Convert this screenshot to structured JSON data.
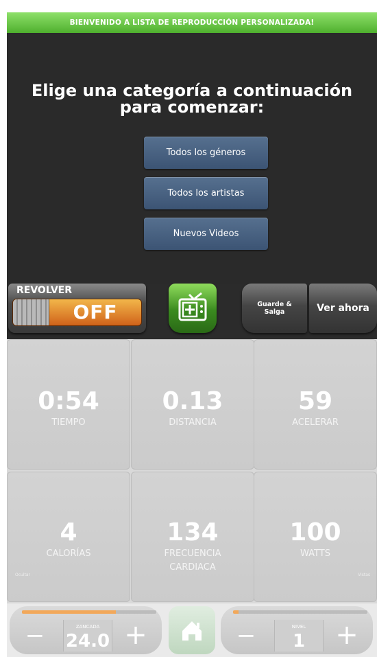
{
  "banner": {
    "text": "BIENVENIDO A LISTA DE REPRODUCCIÓN PERSONALIZADA!"
  },
  "playlist": {
    "heading_line1": "Elige una categoría a continuación",
    "heading_line2": "para comenzar:",
    "buttons": [
      {
        "label": "Todos los géneros"
      },
      {
        "label": "Todos los artistas"
      },
      {
        "label": "Nuevos Videos"
      }
    ]
  },
  "controls": {
    "shuffle_label": "REVOLVER",
    "shuffle_state": "OFF",
    "tv_icon": "tv-add-icon",
    "save_line1": "Guarde &",
    "save_line2": "Salga",
    "watch_now": "Ver ahora"
  },
  "stats": {
    "time": {
      "value": "0:54",
      "label": "TIEMPO"
    },
    "distance": {
      "value": "0.13",
      "label": "DISTANCIA"
    },
    "accelerate": {
      "value": "59",
      "label": "ACELERAR"
    },
    "calories": {
      "value": "4",
      "label": "CALORÍAS"
    },
    "heart_rate": {
      "value": "134",
      "label_line1": "FRECUENCIA",
      "label_line2": "CARDIACA"
    },
    "watts": {
      "value": "100",
      "label": "WATTS"
    },
    "left_side_label": "Ocultar",
    "right_side_label": "Vistas"
  },
  "bottom": {
    "stride": {
      "label": "ZANCADA",
      "value": "24.0",
      "minus": "−",
      "plus": "+",
      "progress": 0.7
    },
    "home_icon": "home-icon",
    "level": {
      "label": "NIVEL",
      "value": "1",
      "minus": "−",
      "plus": "+",
      "progress": 0.04
    }
  },
  "colors": {
    "banner_green": "#5cbf35",
    "category_button": "#4a6384",
    "toggle_orange": "#e07a22",
    "tv_green": "#4a9a28",
    "progress_orange": "#f2a85a"
  }
}
